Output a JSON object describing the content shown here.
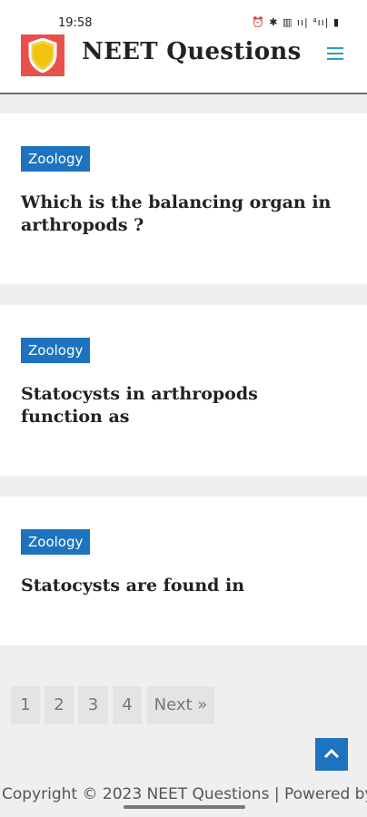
{
  "status_bar": {
    "time": "19:58",
    "icons_text": "⏰ ✱ ▥ ıı| ⁴ıı| ▮",
    "icon_names": [
      "alarm-icon",
      "bluetooth-icon",
      "data-icon",
      "signal-icon",
      "signal-icon",
      "battery-icon"
    ]
  },
  "header": {
    "logo": "shield-logo",
    "title": "NEET Questions",
    "menu_icon": "hamburger-menu-icon"
  },
  "posts": [
    {
      "category": "Zoology",
      "title": "Which is the balancing organ in arthropods ?"
    },
    {
      "category": "Zoology",
      "title": "Statocysts in arthropods function as"
    },
    {
      "category": "Zoology",
      "title": "Statocysts are found in"
    }
  ],
  "pagination": {
    "pages": [
      "1",
      "2",
      "3",
      "4"
    ],
    "next_label": "Next »"
  },
  "footer": {
    "text": "Copyright © 2023 NEET Questions | Powered by"
  },
  "colors": {
    "brand_red": "#e8504b",
    "badge_blue": "#1e73be",
    "menu_blue": "#2e9bd6"
  }
}
